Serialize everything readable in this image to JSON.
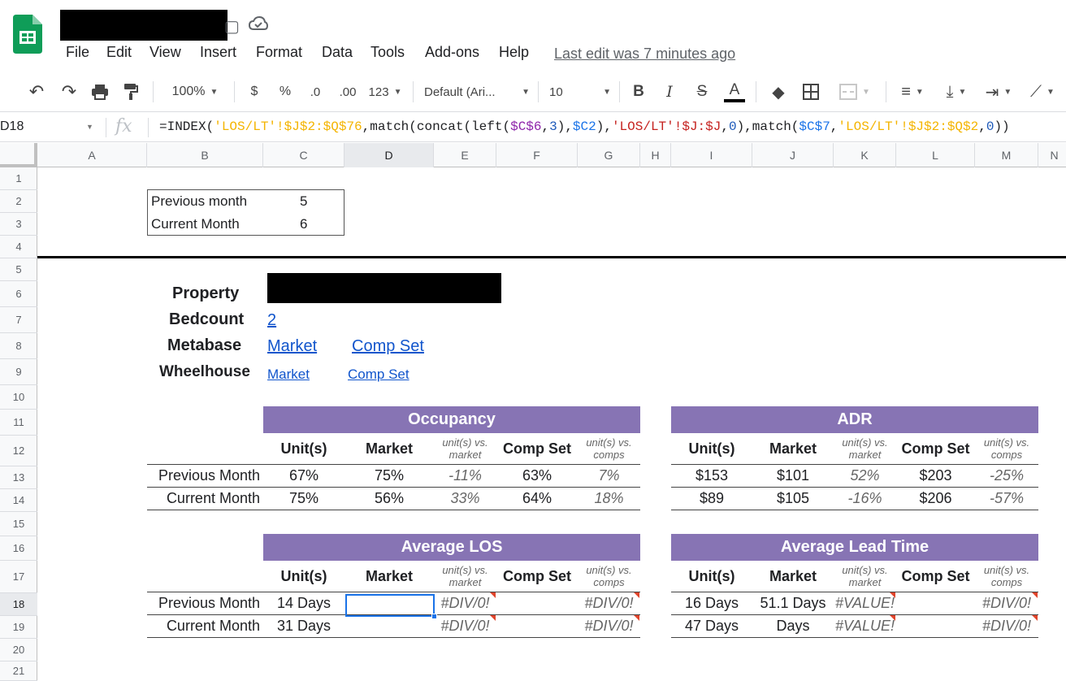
{
  "app": {
    "menus": [
      "File",
      "Edit",
      "View",
      "Insert",
      "Format",
      "Data",
      "Tools",
      "Add-ons",
      "Help"
    ],
    "last_edit": "Last edit was 7 minutes ago"
  },
  "toolbar": {
    "zoom": "100%",
    "currency": "$",
    "percent": "%",
    "dec_decrease": ".0",
    "dec_increase": ".00",
    "more_formats": "123",
    "font": "Default (Ari...",
    "font_size": "10",
    "bold": "B",
    "italic": "I",
    "strike": "S",
    "text_color": "A"
  },
  "formula_bar": {
    "name_box": "D18",
    "fx": "fx",
    "formula": "=INDEX('LOS/LT'!$J$2:$Q$76,match(concat(left($C$6,3),$C2),'LOS/LT'!$J:$J,0),match($C$7,'LOS/LT'!$J$2:$Q$2,0))"
  },
  "columns": [
    "A",
    "B",
    "C",
    "D",
    "E",
    "F",
    "G",
    "H",
    "I",
    "J",
    "K",
    "L",
    "M",
    "N"
  ],
  "rows": [
    "1",
    "2",
    "3",
    "4",
    "5",
    "6",
    "7",
    "8",
    "9",
    "10",
    "11",
    "12",
    "13",
    "14",
    "15",
    "16",
    "17",
    "18",
    "19",
    "20",
    "21"
  ],
  "sheet": {
    "prev_month_label": "Previous month",
    "prev_month_value": "5",
    "curr_month_label": "Current Month",
    "curr_month_value": "6",
    "property_label": "Property",
    "bedcount_label": "Bedcount",
    "bedcount_value": "2",
    "metabase_label": "Metabase",
    "metabase_market": "Market",
    "metabase_comp": "Comp Set",
    "wheelhouse_label": "Wheelhouse",
    "wheelhouse_market": "Market",
    "wheelhouse_comp": "Comp Set"
  },
  "tables": {
    "col_headers": {
      "units": "Unit(s)",
      "market": "Market",
      "vs_market": "unit(s) vs. market",
      "comp_set": "Comp Set",
      "vs_comps": "unit(s) vs. comps"
    },
    "row_labels": {
      "prev": "Previous Month",
      "curr": "Current Month"
    },
    "occupancy": {
      "title": "Occupancy",
      "prev": [
        "67%",
        "75%",
        "-11%",
        "63%",
        "7%"
      ],
      "curr": [
        "75%",
        "56%",
        "33%",
        "64%",
        "18%"
      ]
    },
    "adr": {
      "title": "ADR",
      "prev": [
        "$153",
        "$101",
        "52%",
        "$203",
        "-25%"
      ],
      "curr": [
        "$89",
        "$105",
        "-16%",
        "$206",
        "-57%"
      ]
    },
    "los": {
      "title": "Average LOS",
      "prev": [
        "14 Days",
        "",
        "#DIV/0!",
        "",
        "#DIV/0!"
      ],
      "curr": [
        "31 Days",
        "",
        "#DIV/0!",
        "",
        "#DIV/0!"
      ]
    },
    "lead": {
      "title": "Average Lead Time",
      "prev": [
        "16 Days",
        "51.1 Days",
        "#VALUE!",
        "",
        "#DIV/0!"
      ],
      "curr": [
        "47 Days",
        "Days",
        "#VALUE!",
        "",
        "#DIV/0!"
      ]
    }
  }
}
